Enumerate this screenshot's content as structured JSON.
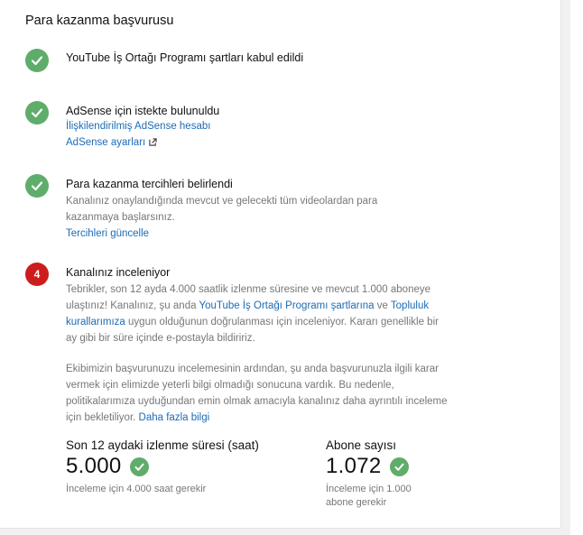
{
  "title": "Para kazanma başvurusu",
  "steps": [
    {
      "status": "done",
      "title": "YouTube İş Ortağı Programı şartları kabul edildi"
    },
    {
      "status": "done",
      "title": "AdSense için istekte bulunuldu",
      "link1": "İlişkilendirilmiş AdSense hesabı",
      "link2": "AdSense ayarları"
    },
    {
      "status": "done",
      "title": "Para kazanma tercihleri belirlendi",
      "desc": "Kanalınız onaylandığında mevcut ve gelecekti tüm videolardan para kazanmaya başlarsınız.",
      "link": "Tercihleri güncelle"
    },
    {
      "status": "in-review",
      "number": "4",
      "title": "Kanalınız inceleniyor",
      "p1_a": "Tebrikler, son 12 ayda 4.000 saatlik izlenme süresine ve mevcut 1.000 aboneye ulaştınız! Kanalınız, şu anda ",
      "p1_link1": "YouTube İş Ortağı Programı şartlarına",
      "p1_b": " ve ",
      "p1_link2": "Topluluk kurallarımıza",
      "p1_c": " uygun olduğunun doğrulanması için inceleniyor. Kararı genellikle bir ay gibi bir süre içinde e-postayla bildiririz.",
      "p2": "Ekibimizin başvurunuzu incelemesinin ardından, şu anda başvurunuzla ilgili karar vermek için elimizde yeterli bilgi olmadığı sonucuna vardık. Bu nedenle, politikalarımıza uyduğundan emin olmak amacıyla kanalınız daha ayrıntılı inceleme için bekletiliyor. ",
      "p2_link": "Daha fazla bilgi"
    }
  ],
  "stats": {
    "watch": {
      "label": "Son 12 aydaki izlenme süresi (saat)",
      "value": "5.000",
      "note": "İnceleme için 4.000 saat gerekir"
    },
    "subs": {
      "label": "Abone sayısı",
      "value": "1.072",
      "note": "İnceleme için 1.000 abone gerekir"
    }
  },
  "colors": {
    "done": "#5fad6a",
    "in_review": "#cc1d1d",
    "link": "#1c6bb5"
  }
}
